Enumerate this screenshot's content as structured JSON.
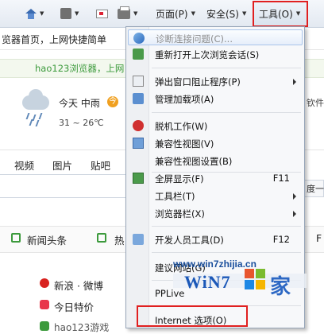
{
  "toolbar": {
    "page_label": "页面(P)",
    "safety_label": "安全(S)",
    "tools_label": "工具(O)"
  },
  "background": {
    "address_text": "览器首页，上网快捷简单",
    "green_row_text": "hao123浏览器，上网",
    "weather_today": "今天 中雨",
    "weather_badge": "今",
    "weather_temp": "31 ~ 26℃",
    "tab_video": "视频",
    "tab_image": "图片",
    "tab_tieba": "贴吧",
    "right_fragment_1": "钦件",
    "right_fragment_2": "度一",
    "news_label": "新闻头条",
    "hot_label": "热",
    "right_fragment_3": "F",
    "link_sina": "新浪 · 微博",
    "link_deals": "今日特价",
    "link_bottom": "hao123游戏"
  },
  "menu": {
    "items": [
      {
        "label": "诊断连接问题(C)...",
        "shortcut": "",
        "disabled": true,
        "icon": "diagnose-icon"
      },
      {
        "label": "重新打开上次浏览会话(S)",
        "shortcut": "",
        "icon": "reopen-icon"
      },
      {
        "label": "弹出窗口阻止程序(P)",
        "shortcut": "",
        "submenu": true,
        "icon": "popup-blocker-icon"
      },
      {
        "label": "管理加载项(A)",
        "shortcut": "",
        "icon": "addons-icon"
      },
      {
        "label": "脱机工作(W)",
        "shortcut": "",
        "icon": "offline-icon"
      },
      {
        "label": "兼容性视图(V)",
        "shortcut": "",
        "icon": "compat-view-icon"
      },
      {
        "label": "兼容性视图设置(B)",
        "shortcut": "",
        "icon": ""
      },
      {
        "label": "全屏显示(F)",
        "shortcut": "F11",
        "icon": "fullscreen-icon"
      },
      {
        "label": "工具栏(T)",
        "shortcut": "",
        "submenu": true,
        "icon": ""
      },
      {
        "label": "浏览器栏(X)",
        "shortcut": "",
        "submenu": true,
        "icon": ""
      },
      {
        "label": "开发人员工具(D)",
        "shortcut": "F12",
        "icon": "dev-tools-icon"
      },
      {
        "label": "建议网站(G)",
        "shortcut": "",
        "icon": ""
      },
      {
        "label": "PPLive",
        "shortcut": "",
        "icon": ""
      },
      {
        "label": "Internet 选项(O)",
        "shortcut": "",
        "icon": ""
      }
    ]
  },
  "watermark": {
    "url": "www.win7zhijia.cn",
    "logo": "WiN7",
    "suffix": "家"
  },
  "colors": {
    "highlight_red": "#e02020",
    "menu_bg": "#f7f8fa",
    "accent_green": "#3c9a3c"
  }
}
